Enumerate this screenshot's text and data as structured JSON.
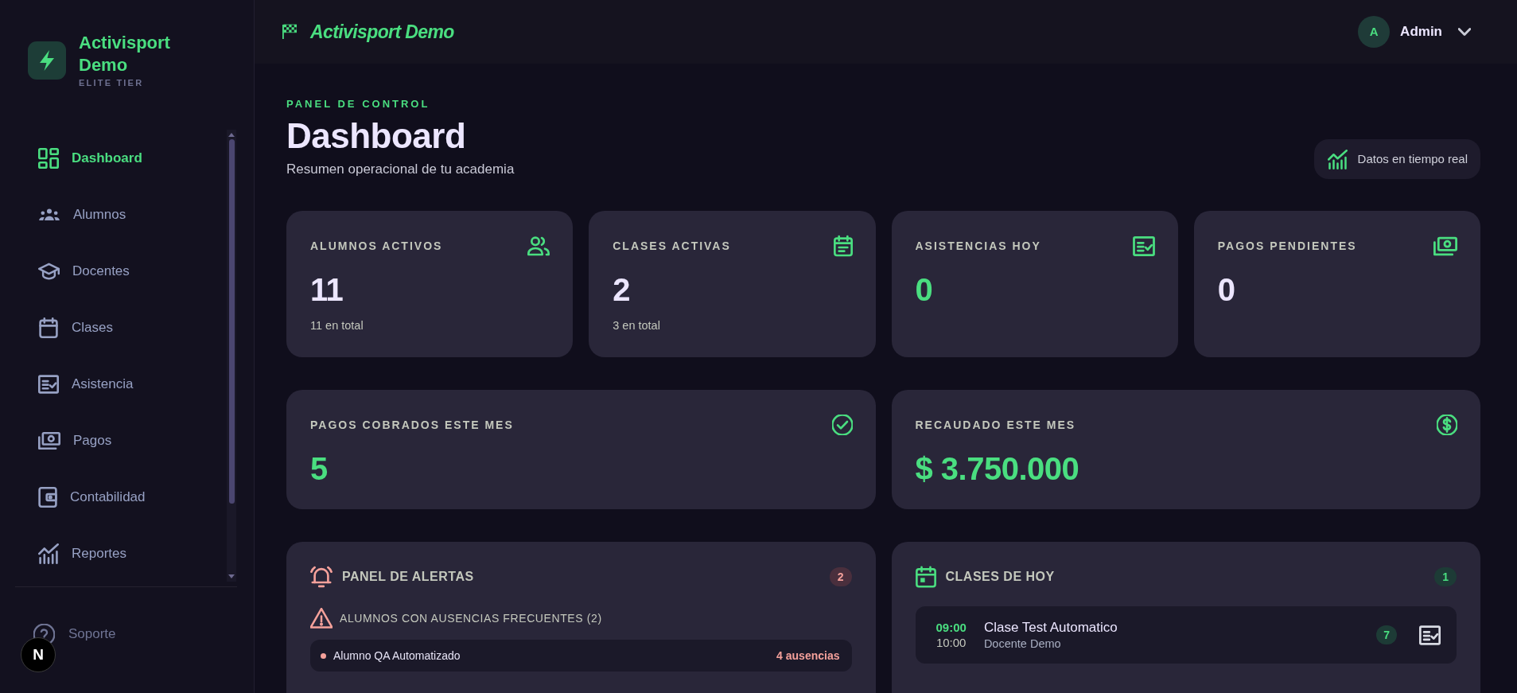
{
  "sidebar": {
    "brand": {
      "name": "Activisport Demo",
      "tier": "ELITE TIER"
    },
    "items": [
      {
        "label": "Dashboard",
        "selected": true
      },
      {
        "label": "Alumnos",
        "selected": false
      },
      {
        "label": "Docentes",
        "selected": false
      },
      {
        "label": "Clases",
        "selected": false
      },
      {
        "label": "Asistencia",
        "selected": false
      },
      {
        "label": "Pagos",
        "selected": false
      },
      {
        "label": "Contabilidad",
        "selected": false
      },
      {
        "label": "Reportes",
        "selected": false
      }
    ],
    "footer": {
      "label": "Soporte"
    }
  },
  "dev_indicator": {
    "label": "N"
  },
  "header": {
    "title": "Activisport Demo",
    "user": {
      "initial": "A",
      "name": "Admin"
    }
  },
  "page": {
    "eyebrow": "PANEL DE CONTROL",
    "title": "Dashboard",
    "subtitle": "Resumen operacional de tu academia",
    "live_badge": "Datos en tiempo real"
  },
  "stats": [
    {
      "label": "ALUMNOS ACTIVOS",
      "value": "11",
      "note": "11 en total",
      "highlight": false
    },
    {
      "label": "CLASES ACTIVAS",
      "value": "2",
      "note": "3 en total",
      "highlight": false
    },
    {
      "label": "ASISTENCIAS HOY",
      "value": "0",
      "highlight": true
    },
    {
      "label": "PAGOS PENDIENTES",
      "value": "0",
      "highlight": false
    }
  ],
  "summary": [
    {
      "label": "PAGOS COBRADOS ESTE MES",
      "value": "5",
      "highlight": true
    },
    {
      "label": "RECAUDADO ESTE MES",
      "value": "$ 3.750.000",
      "highlight": true
    }
  ],
  "alerts": {
    "title": "PANEL DE ALERTAS",
    "count": "2",
    "group": {
      "title": "ALUMNOS CON AUSENCIAS FRECUENTES (2)",
      "rows": [
        {
          "name": "Alumno QA Automatizado",
          "value": "4 ausencias"
        }
      ]
    }
  },
  "classes_today": {
    "title": "CLASES DE HOY",
    "count": "1",
    "rows": [
      {
        "start": "09:00",
        "end": "10:00",
        "name": "Clase Test Automatico",
        "teacher": "Docente Demo",
        "students": "7"
      }
    ]
  }
}
